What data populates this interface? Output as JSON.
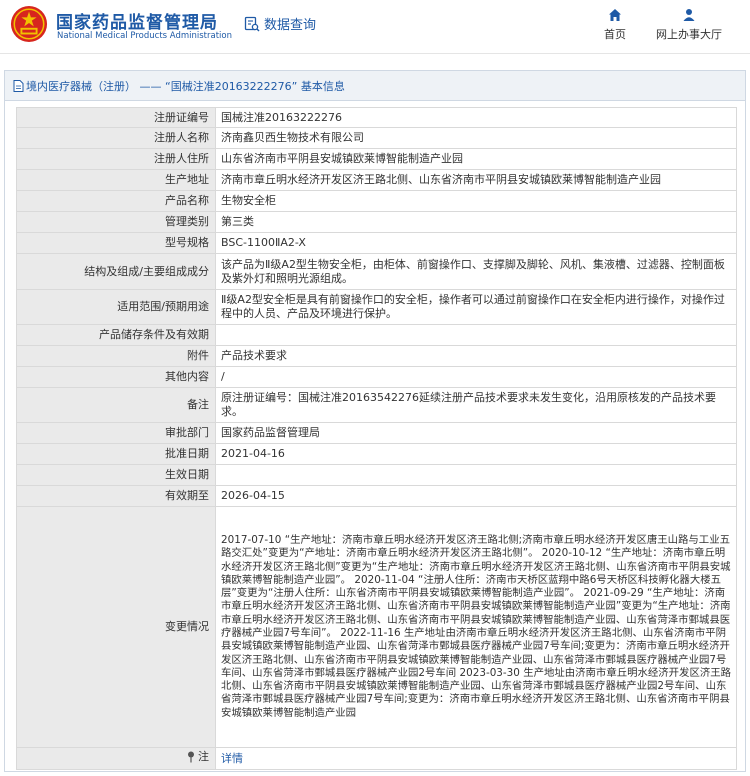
{
  "header": {
    "brand_cn": "国家药品监督管理局",
    "brand_en": "National Medical Products Administration",
    "search_label": "数据查询",
    "nav": [
      {
        "label": "首页",
        "icon": "home-icon"
      },
      {
        "label": "网上办事大厅",
        "icon": "person-icon"
      }
    ],
    "colors": {
      "brand": "#1f5aa6",
      "logo_red": "#d7261e",
      "logo_gold": "#f2c200"
    }
  },
  "breadcrumb": "境内医疗器械（注册） —— “国械注准20163222276” 基本信息",
  "rows": [
    {
      "label": "注册证编号",
      "value": "国械注准20163222276"
    },
    {
      "label": "注册人名称",
      "value": "济南鑫贝西生物技术有限公司"
    },
    {
      "label": "注册人住所",
      "value": "山东省济南市平阴县安城镇欧莱博智能制造产业园"
    },
    {
      "label": "生产地址",
      "value": "济南市章丘明水经济开发区济王路北侧、山东省济南市平阴县安城镇欧莱博智能制造产业园"
    },
    {
      "label": "产品名称",
      "value": "生物安全柜"
    },
    {
      "label": "管理类别",
      "value": "第三类"
    },
    {
      "label": "型号规格",
      "value": "BSC-1100ⅡA2-X"
    },
    {
      "label": "结构及组成/主要组成成分",
      "value": "该产品为Ⅱ级A2型生物安全柜，由柜体、前窗操作口、支撑脚及脚轮、风机、集液槽、过滤器、控制面板及紫外灯和照明光源组成。"
    },
    {
      "label": "适用范围/预期用途",
      "value": "Ⅱ级A2型安全柜是具有前窗操作口的安全柜，操作者可以通过前窗操作口在安全柜内进行操作，对操作过程中的人员、产品及环境进行保护。"
    },
    {
      "label": "产品储存条件及有效期",
      "value": ""
    },
    {
      "label": "附件",
      "value": "产品技术要求"
    },
    {
      "label": "其他内容",
      "value": "/"
    },
    {
      "label": "备注",
      "value": "原注册证编号：国械注准20163542276延续注册产品技术要求未发生变化，沿用原核发的产品技术要求。"
    },
    {
      "label": "审批部门",
      "value": "国家药品监督管理局"
    },
    {
      "label": "批准日期",
      "value": "2021-04-16"
    },
    {
      "label": "生效日期",
      "value": ""
    },
    {
      "label": "有效期至",
      "value": "2026-04-15"
    },
    {
      "label": "变更情况",
      "value": "2017-07-10 “生产地址：济南市章丘明水经济开发区济王路北侧;济南市章丘明水经济开发区唐王山路与工业五路交汇处”变更为“产地址：济南市章丘明水经济开发区济王路北侧”。 2020-10-12 “生产地址：济南市章丘明水经济开发区济王路北侧”变更为“生产地址：济南市章丘明水经济开发区济王路北侧、山东省济南市平阴县安城镇欧莱博智能制造产业园”。 2020-11-04 “注册人住所：济南市天桥区蓝翔中路6号天桥区科技孵化器大楼五层”变更为“注册人住所：山东省济南市平阴县安城镇欧莱博智能制造产业园”。 2021-09-29 “生产地址：济南市章丘明水经济开发区济王路北侧、山东省济南市平阴县安城镇欧莱博智能制造产业园”变更为“生产地址：济南市章丘明水经济开发区济王路北侧、山东省济南市平阴县安城镇欧莱博智能制造产业园、山东省菏泽市鄄城县医疗器械产业园7号车间”。 2022-11-16 生产地址由济南市章丘明水经济开发区济王路北侧、山东省济南市平阴县安城镇欧莱博智能制造产业园、山东省菏泽市鄄城县医疗器械产业园7号车间;变更为：济南市章丘明水经济开发区济王路北侧、山东省济南市平阴县安城镇欧莱博智能制造产业园、山东省菏泽市鄄城县医疗器械产业园7号车间、山东省菏泽市鄄城县医疗器械产业园2号车间 2023-03-30 生产地址由济南市章丘明水经济开发区济王路北侧、山东省济南市平阴县安城镇欧莱博智能制造产业园、山东省菏泽市鄄城县医疗器械产业园2号车间、山东省菏泽市鄄城县医疗器械产业园7号车间;变更为：济南市章丘明水经济开发区济王路北侧、山东省济南市平阴县安城镇欧莱博智能制造产业园"
    }
  ],
  "footer_row": {
    "label": "注",
    "link": "详情"
  }
}
